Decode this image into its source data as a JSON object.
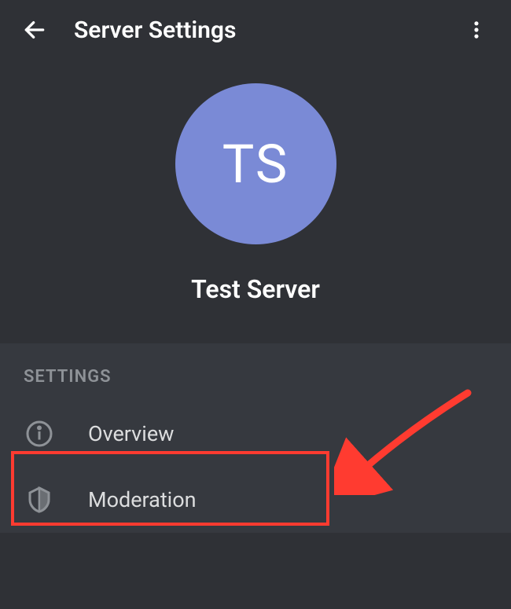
{
  "header": {
    "title": "Server Settings"
  },
  "server": {
    "avatar_initials": "TS",
    "name": "Test Server"
  },
  "section": {
    "label": "SETTINGS"
  },
  "menu": {
    "overview": {
      "label": "Overview"
    },
    "moderation": {
      "label": "Moderation"
    }
  }
}
